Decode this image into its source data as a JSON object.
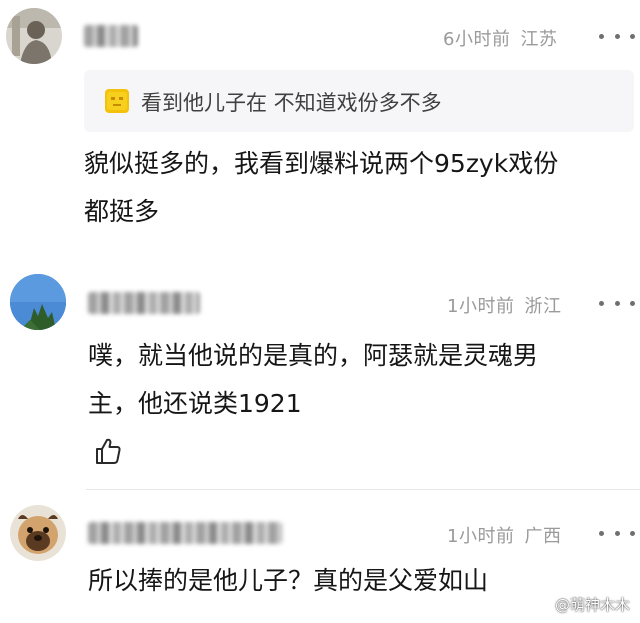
{
  "comments": [
    {
      "time": "6小时前",
      "location": "江苏",
      "quote_icon": "emoji-face-icon",
      "quote": "看到他儿子在 不知道戏份多不多",
      "lines": [
        "貌似挺多的，我看到爆料说两个95zyk戏份",
        "都挺多"
      ]
    },
    {
      "time": "1小时前",
      "location": "浙江",
      "lines": [
        "噗，就当他说的是真的，阿瑟就是灵魂男",
        "主，他还说类1921"
      ],
      "like_icon": "thumbs-up-icon"
    },
    {
      "time": "1小时前",
      "location": "广西",
      "lines": [
        "所以捧的是他儿子？真的是父爱如山"
      ]
    }
  ],
  "watermark": "@萌神木木",
  "colors": {
    "meta": "#9a9a9a",
    "quote_bg": "#f6f6f8",
    "text": "#161616"
  }
}
